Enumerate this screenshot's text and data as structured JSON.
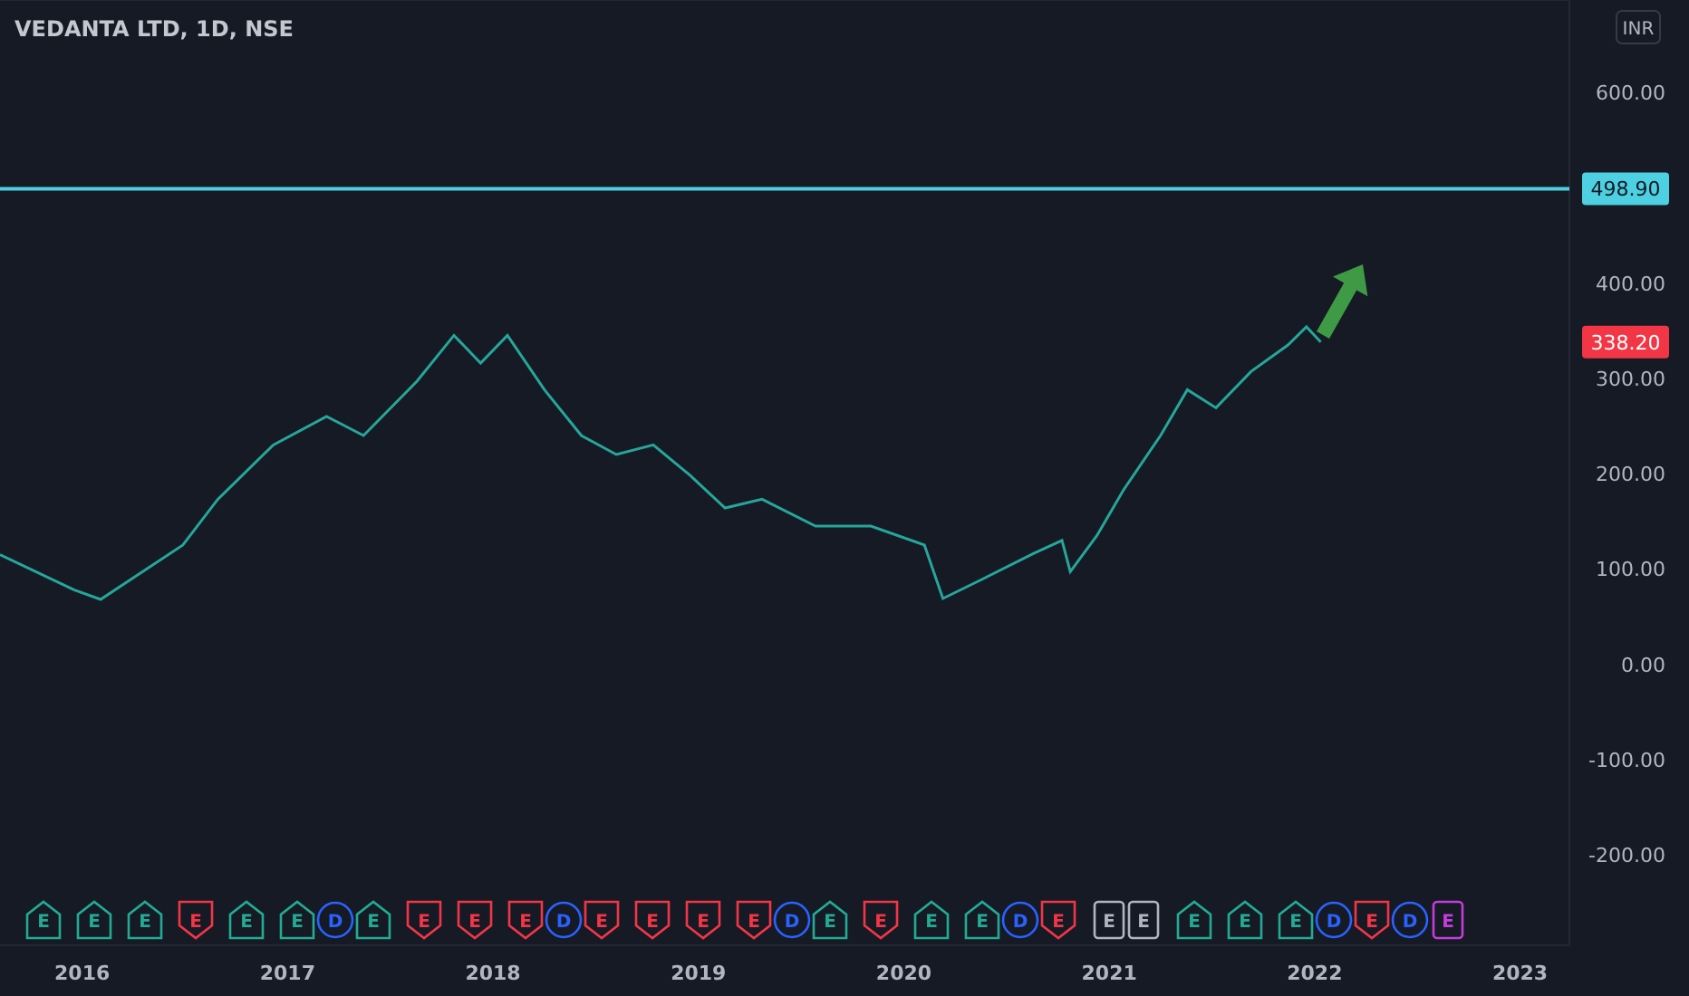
{
  "currency": "INR",
  "chart_data": {
    "type": "line",
    "title": "VEDANTA LTD, 1D, NSE",
    "x": [
      2015.6,
      2015.96,
      2016.09,
      2016.49,
      2016.66,
      2016.93,
      2017.19,
      2017.37,
      2017.63,
      2017.81,
      2017.94,
      2018.07,
      2018.25,
      2018.43,
      2018.6,
      2018.78,
      2018.96,
      2019.13,
      2019.31,
      2019.57,
      2019.84,
      2020.1,
      2020.19,
      2020.37,
      2020.63,
      2020.77,
      2020.81,
      2020.94,
      2021.07,
      2021.25,
      2021.38,
      2021.52,
      2021.69,
      2021.87,
      2021.96,
      2022.03,
      2023.24
    ],
    "series": [
      {
        "color": "#26a69a",
        "values": [
          115,
          78,
          68,
          125,
          173,
          230,
          260,
          240,
          297,
          345,
          316,
          345,
          288,
          240,
          220,
          230,
          198,
          164,
          173,
          145,
          145,
          125,
          69,
          88,
          116,
          130,
          97,
          135,
          183,
          240,
          288,
          269,
          307,
          335,
          354,
          338,
          null
        ]
      },
      {
        "color": "#4dd0e1",
        "values": [
          499,
          499,
          499,
          499,
          499,
          499,
          499,
          499,
          499,
          499,
          499,
          499,
          499,
          499,
          499,
          499,
          499,
          499,
          499,
          499,
          499,
          499,
          499,
          499,
          499,
          499,
          499,
          499,
          499,
          499,
          499,
          499,
          499,
          499,
          499,
          499,
          499
        ]
      }
    ],
    "xlim": [
      2015.6,
      2023.24
    ],
    "ylim": [
      -295,
      697
    ],
    "xticks": [
      {
        "value": 2016,
        "label": "2016"
      },
      {
        "value": 2017,
        "label": "2017"
      },
      {
        "value": 2018,
        "label": "2018"
      },
      {
        "value": 2019,
        "label": "2019"
      },
      {
        "value": 2020,
        "label": "2020"
      },
      {
        "value": 2021,
        "label": "2021"
      },
      {
        "value": 2022,
        "label": "2022"
      },
      {
        "value": 2023,
        "label": "2023"
      }
    ],
    "yticks": [
      {
        "value": 600,
        "label": "600.00"
      },
      {
        "value": 400,
        "label": "400.00"
      },
      {
        "value": 300,
        "label": "300.00"
      },
      {
        "value": 200,
        "label": "200.00"
      },
      {
        "value": 100,
        "label": "100.00"
      },
      {
        "value": 0,
        "label": "0.00"
      },
      {
        "value": -100,
        "label": "-100.00"
      },
      {
        "value": -200,
        "label": "-200.00"
      }
    ]
  },
  "price_labels": [
    {
      "text": "498.90",
      "color": "#4dd0e1"
    },
    {
      "text": "338.20",
      "color": "#f23645"
    }
  ],
  "events": [
    {
      "kind": "earnings",
      "label": "E",
      "color": "#22ab94"
    },
    {
      "kind": "earnings",
      "label": "E",
      "color": "#22ab94"
    },
    {
      "kind": "earnings",
      "label": "E",
      "color": "#22ab94"
    },
    {
      "kind": "earnings",
      "label": "E",
      "color": "#f23645"
    },
    {
      "kind": "earnings",
      "label": "E",
      "color": "#22ab94"
    },
    {
      "kind": "earnings",
      "label": "E",
      "color": "#22ab94"
    },
    {
      "kind": "dividend",
      "label": "D",
      "color": "#2962ff"
    },
    {
      "kind": "earnings",
      "label": "E",
      "color": "#22ab94"
    },
    {
      "kind": "earnings",
      "label": "E",
      "color": "#f23645"
    },
    {
      "kind": "earnings",
      "label": "E",
      "color": "#f23645"
    },
    {
      "kind": "earnings",
      "label": "E",
      "color": "#f23645"
    },
    {
      "kind": "dividend",
      "label": "D",
      "color": "#2962ff"
    },
    {
      "kind": "earnings",
      "label": "E",
      "color": "#f23645"
    },
    {
      "kind": "earnings",
      "label": "E",
      "color": "#f23645"
    },
    {
      "kind": "earnings",
      "label": "E",
      "color": "#f23645"
    },
    {
      "kind": "earnings",
      "label": "E",
      "color": "#f23645"
    },
    {
      "kind": "dividend",
      "label": "D",
      "color": "#2962ff"
    },
    {
      "kind": "earnings",
      "label": "E",
      "color": "#22ab94"
    },
    {
      "kind": "earnings",
      "label": "E",
      "color": "#f23645"
    },
    {
      "kind": "earnings",
      "label": "E",
      "color": "#22ab94"
    },
    {
      "kind": "earnings",
      "label": "E",
      "color": "#22ab94"
    },
    {
      "kind": "dividend",
      "label": "D",
      "color": "#2962ff"
    },
    {
      "kind": "earnings",
      "label": "E",
      "color": "#f23645"
    },
    {
      "kind": "future",
      "label": "E",
      "color": "#b2b5be"
    },
    {
      "kind": "future",
      "label": "E",
      "color": "#b2b5be"
    },
    {
      "kind": "earnings",
      "label": "E",
      "color": "#22ab94"
    },
    {
      "kind": "earnings",
      "label": "E",
      "color": "#22ab94"
    },
    {
      "kind": "earnings",
      "label": "E",
      "color": "#22ab94"
    },
    {
      "kind": "dividend",
      "label": "D",
      "color": "#2962ff"
    },
    {
      "kind": "earnings",
      "label": "E",
      "color": "#f23645"
    },
    {
      "kind": "dividend",
      "label": "D",
      "color": "#2962ff"
    },
    {
      "kind": "future",
      "label": "E",
      "color": "#c43ddb"
    }
  ]
}
